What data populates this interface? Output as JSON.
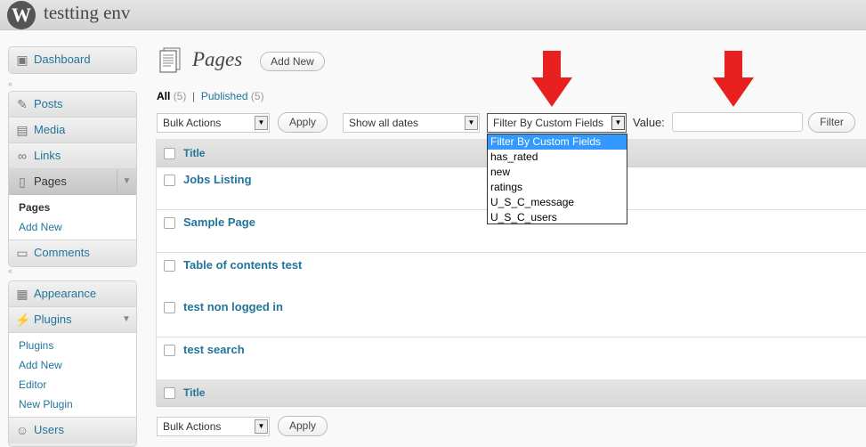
{
  "site": {
    "title": "testting env"
  },
  "sidebar": {
    "dashboard": "Dashboard",
    "posts": "Posts",
    "media": "Media",
    "links": "Links",
    "pages": "Pages",
    "pages_sub": [
      "Pages",
      "Add New"
    ],
    "comments": "Comments",
    "appearance": "Appearance",
    "plugins": "Plugins",
    "plugins_sub": [
      "Plugins",
      "Add New",
      "Editor",
      "New Plugin"
    ],
    "users": "Users"
  },
  "page": {
    "title": "Pages",
    "add_new": "Add New",
    "filters": {
      "all_label": "All",
      "all_count": "(5)",
      "published_label": "Published",
      "published_count": "(5)"
    }
  },
  "toolbar": {
    "bulk_actions": "Bulk Actions",
    "apply": "Apply",
    "dates": "Show all dates",
    "custom_fields": "Filter By Custom Fields",
    "value_label": "Value:",
    "filter": "Filter"
  },
  "custom_fields_options": [
    "Filter By Custom Fields",
    "has_rated",
    "new",
    "ratings",
    "U_S_C_message",
    "U_S_C_users"
  ],
  "table": {
    "header_title": "Title",
    "rows": [
      "Jobs Listing",
      "Sample Page",
      "Table of contents test",
      "test non logged in",
      "test search"
    ]
  },
  "colors": {
    "link": "#21759b",
    "arrow": "#e8201f",
    "selected_option": "#3399ff"
  }
}
